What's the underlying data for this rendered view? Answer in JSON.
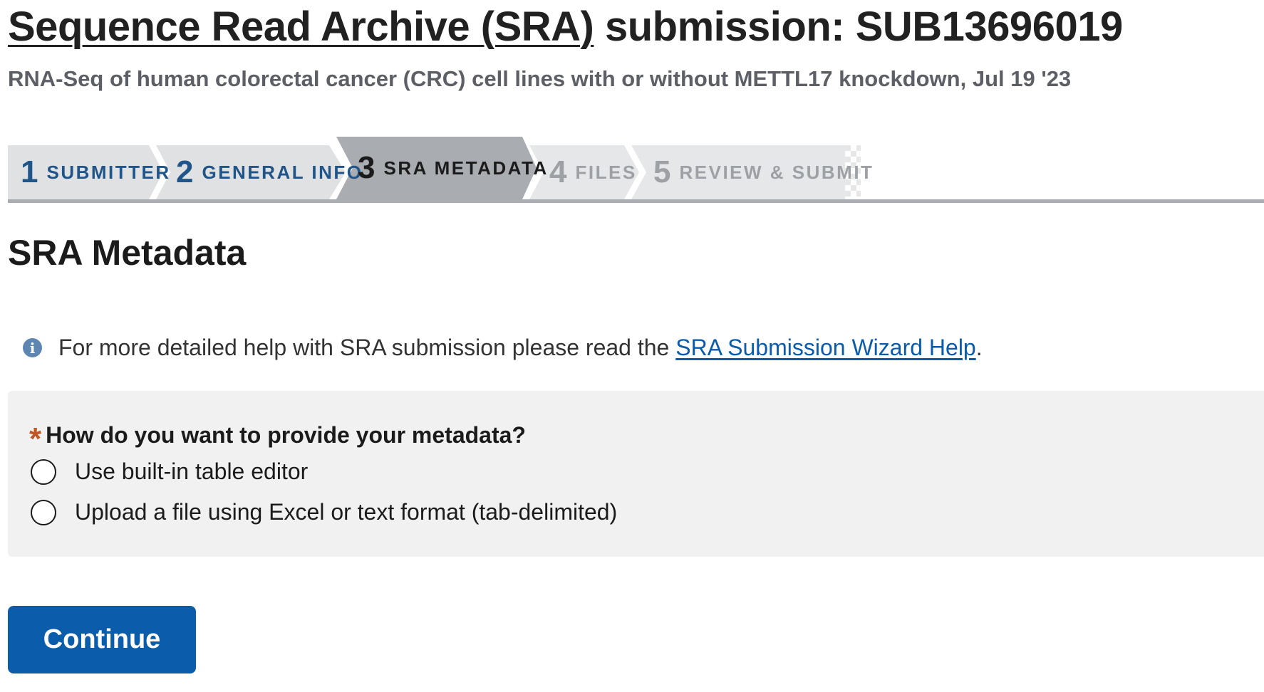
{
  "header": {
    "title_link": "Sequence Read Archive (SRA)",
    "title_rest": " submission: SUB13696019",
    "subtitle": "RNA-Seq of human colorectal cancer (CRC) cell lines with or without METTL17 knockdown, Jul 19 '23"
  },
  "stepper": {
    "steps": [
      {
        "number": "1",
        "label": "SUBMITTER",
        "state": "done"
      },
      {
        "number": "2",
        "label": "GENERAL INFO",
        "state": "done"
      },
      {
        "number": "3",
        "label": "SRA METADATA",
        "state": "current"
      },
      {
        "number": "4",
        "label": "FILES",
        "state": "future"
      },
      {
        "number": "5",
        "label": "REVIEW & SUBMIT",
        "state": "future"
      }
    ],
    "colors": {
      "done": "#e0e1e2",
      "current": "#a9acb0",
      "future": "#e6e7e8"
    }
  },
  "main": {
    "section_title": "SRA Metadata",
    "info": {
      "icon": "info-icon",
      "text_before": "For more detailed help with SRA submission please read the ",
      "link_text": "SRA Submission Wizard Help",
      "text_after": "."
    },
    "question": {
      "required_marker": "*",
      "label": "How do you want to provide your metadata?",
      "options": [
        {
          "label": "Use built-in table editor",
          "selected": false
        },
        {
          "label": "Upload a file using Excel or text format (tab-delimited)",
          "selected": false
        }
      ]
    },
    "continue_label": "Continue"
  },
  "colors": {
    "accent": "#0b5cab",
    "link": "#0a5bab",
    "required": "#c05621",
    "subtitle": "#5c5f66"
  }
}
